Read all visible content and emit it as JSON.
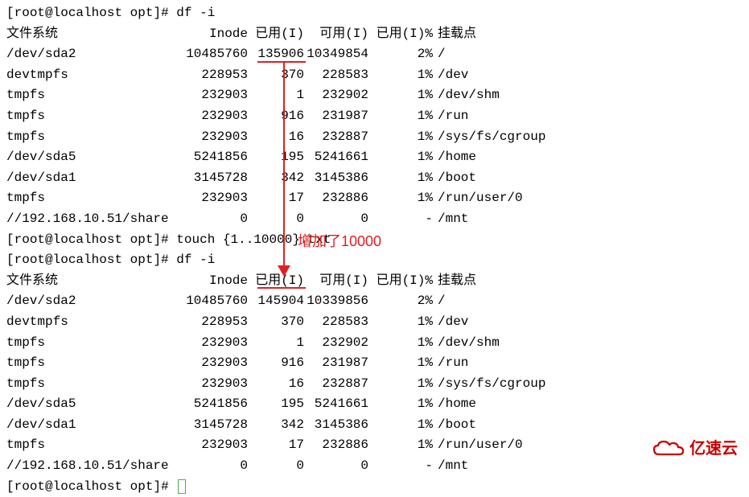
{
  "prompt": {
    "user": "root",
    "host": "localhost",
    "path": "opt",
    "symbol": "#"
  },
  "commands": {
    "df1": "df -i",
    "touch": "touch {1..10000}.txt",
    "df2": "df -i"
  },
  "header": {
    "fs": "文件系统",
    "inode": "Inode",
    "used": "已用(I)",
    "avail": "可用(I)",
    "pct": "已用(I)%",
    "mount": "挂载点"
  },
  "table1": [
    {
      "fs": "/dev/sda2",
      "inode": "10485760",
      "used": "135906",
      "avail": "10349854",
      "pct": "2%",
      "mount": "/"
    },
    {
      "fs": "devtmpfs",
      "inode": "228953",
      "used": "370",
      "avail": "228583",
      "pct": "1%",
      "mount": "/dev"
    },
    {
      "fs": "tmpfs",
      "inode": "232903",
      "used": "1",
      "avail": "232902",
      "pct": "1%",
      "mount": "/dev/shm"
    },
    {
      "fs": "tmpfs",
      "inode": "232903",
      "used": "916",
      "avail": "231987",
      "pct": "1%",
      "mount": "/run"
    },
    {
      "fs": "tmpfs",
      "inode": "232903",
      "used": "16",
      "avail": "232887",
      "pct": "1%",
      "mount": "/sys/fs/cgroup"
    },
    {
      "fs": "/dev/sda5",
      "inode": "5241856",
      "used": "195",
      "avail": "5241661",
      "pct": "1%",
      "mount": "/home"
    },
    {
      "fs": "/dev/sda1",
      "inode": "3145728",
      "used": "342",
      "avail": "3145386",
      "pct": "1%",
      "mount": "/boot"
    },
    {
      "fs": "tmpfs",
      "inode": "232903",
      "used": "17",
      "avail": "232886",
      "pct": "1%",
      "mount": "/run/user/0"
    },
    {
      "fs": "//192.168.10.51/share",
      "inode": "0",
      "used": "0",
      "avail": "0",
      "pct": "-",
      "mount": "/mnt"
    }
  ],
  "table2": [
    {
      "fs": "/dev/sda2",
      "inode": "10485760",
      "used": "145904",
      "avail": "10339856",
      "pct": "2%",
      "mount": "/"
    },
    {
      "fs": "devtmpfs",
      "inode": "228953",
      "used": "370",
      "avail": "228583",
      "pct": "1%",
      "mount": "/dev"
    },
    {
      "fs": "tmpfs",
      "inode": "232903",
      "used": "1",
      "avail": "232902",
      "pct": "1%",
      "mount": "/dev/shm"
    },
    {
      "fs": "tmpfs",
      "inode": "232903",
      "used": "916",
      "avail": "231987",
      "pct": "1%",
      "mount": "/run"
    },
    {
      "fs": "tmpfs",
      "inode": "232903",
      "used": "16",
      "avail": "232887",
      "pct": "1%",
      "mount": "/sys/fs/cgroup"
    },
    {
      "fs": "/dev/sda5",
      "inode": "5241856",
      "used": "195",
      "avail": "5241661",
      "pct": "1%",
      "mount": "/home"
    },
    {
      "fs": "/dev/sda1",
      "inode": "3145728",
      "used": "342",
      "avail": "3145386",
      "pct": "1%",
      "mount": "/boot"
    },
    {
      "fs": "tmpfs",
      "inode": "232903",
      "used": "17",
      "avail": "232886",
      "pct": "1%",
      "mount": "/run/user/0"
    },
    {
      "fs": "//192.168.10.51/share",
      "inode": "0",
      "used": "0",
      "avail": "0",
      "pct": "-",
      "mount": "/mnt"
    }
  ],
  "annotation": "增加了10000",
  "logo": "亿速云"
}
